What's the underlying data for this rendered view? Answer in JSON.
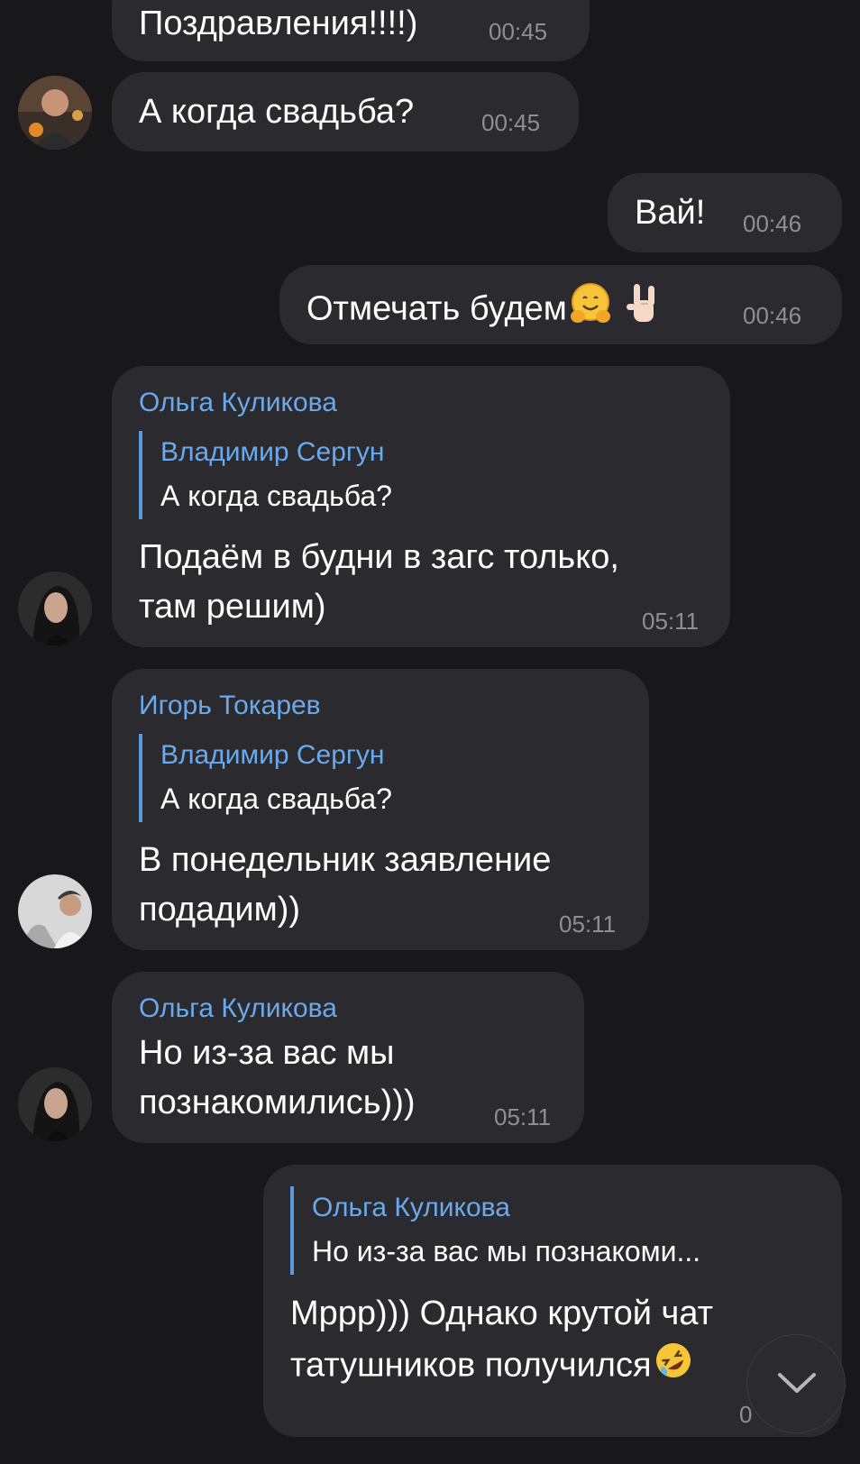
{
  "messages": [
    {
      "text": "Поздравления!!!!)",
      "time": "00:45"
    },
    {
      "text": "А когда свадьба?",
      "time": "00:45"
    },
    {
      "text": "Вай!",
      "time": "00:46"
    },
    {
      "text": "Отмечать будем",
      "time": "00:46",
      "emojis": [
        "hugging-face-emoji",
        "sign-of-horns-emoji"
      ]
    },
    {
      "sender": "Ольга Куликова",
      "reply_name": "Владимир Сергун",
      "reply_text": "А когда свадьба?",
      "lines": [
        "Подаём в будни в загс только,",
        "там решим)"
      ],
      "time": "05:11"
    },
    {
      "sender": "Игорь Токарев",
      "reply_name": "Владимир Сергун",
      "reply_text": "А когда свадьба?",
      "lines": [
        "В понедельник заявление",
        "подадим))"
      ],
      "time": "05:11"
    },
    {
      "sender": "Ольга Куликова",
      "lines": [
        "Но из-за вас мы",
        "познакомились)))"
      ],
      "time": "05:11"
    },
    {
      "reply_name": "Ольга Куликова",
      "reply_text": "Но из-за вас мы познакоми...",
      "lines": [
        "Мррр))) Однако крутой чат",
        "татушников получился"
      ],
      "emojis": [
        "rolling-on-floor-laughing-emoji"
      ],
      "time_partial": "0"
    }
  ],
  "colors": {
    "background": "#18181a",
    "bubble": "#2b2b2f",
    "name_accent": "#6aa9ec",
    "timestamp": "#8e8e93"
  },
  "icons": {
    "scroll_down": "chevron-down-icon"
  }
}
